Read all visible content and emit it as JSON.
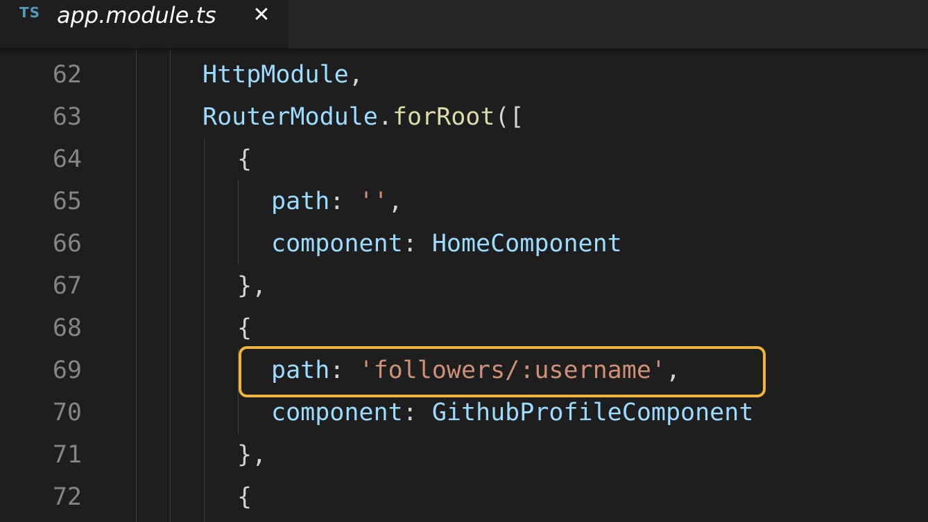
{
  "tab": {
    "language_badge": "TS",
    "filename": "app.module.ts",
    "close_glyph": "✕",
    "close_icon": "close-icon"
  },
  "colors": {
    "editor_background": "#1e1e1e",
    "highlight_border": "#f0b43c",
    "string": "#ce9178",
    "property": "#9cdcfe",
    "function": "#dcdcaa",
    "line_number": "#858585"
  },
  "editor": {
    "lines": [
      {
        "number": "62",
        "tokens": [
          {
            "t": "HttpModule",
            "k": "type"
          },
          {
            "t": ",",
            "k": "punc"
          }
        ]
      },
      {
        "number": "63",
        "tokens": [
          {
            "t": "RouterModule",
            "k": "type"
          },
          {
            "t": ".",
            "k": "punc"
          },
          {
            "t": "forRoot",
            "k": "fn"
          },
          {
            "t": "([",
            "k": "punc"
          }
        ]
      },
      {
        "number": "64",
        "tokens": [
          {
            "t": "{",
            "k": "punc"
          }
        ]
      },
      {
        "number": "65",
        "tokens": [
          {
            "t": "path",
            "k": "prop"
          },
          {
            "t": ": ",
            "k": "punc"
          },
          {
            "t": "''",
            "k": "str"
          },
          {
            "t": ",",
            "k": "punc"
          }
        ]
      },
      {
        "number": "66",
        "tokens": [
          {
            "t": "component",
            "k": "prop"
          },
          {
            "t": ": ",
            "k": "punc"
          },
          {
            "t": "HomeComponent",
            "k": "type"
          }
        ]
      },
      {
        "number": "67",
        "tokens": [
          {
            "t": "},",
            "k": "punc"
          }
        ]
      },
      {
        "number": "68",
        "tokens": [
          {
            "t": "{",
            "k": "punc"
          }
        ]
      },
      {
        "number": "69",
        "tokens": [
          {
            "t": "path",
            "k": "prop"
          },
          {
            "t": ": ",
            "k": "punc"
          },
          {
            "t": "'followers/:username'",
            "k": "str"
          },
          {
            "t": ",",
            "k": "punc"
          }
        ],
        "highlighted": true
      },
      {
        "number": "70",
        "tokens": [
          {
            "t": "component",
            "k": "prop"
          },
          {
            "t": ": ",
            "k": "punc"
          },
          {
            "t": "GithubProfileComponent",
            "k": "type"
          }
        ]
      },
      {
        "number": "71",
        "tokens": [
          {
            "t": "},",
            "k": "punc"
          }
        ]
      },
      {
        "number": "72",
        "tokens": [
          {
            "t": "{",
            "k": "punc"
          }
        ]
      }
    ]
  }
}
